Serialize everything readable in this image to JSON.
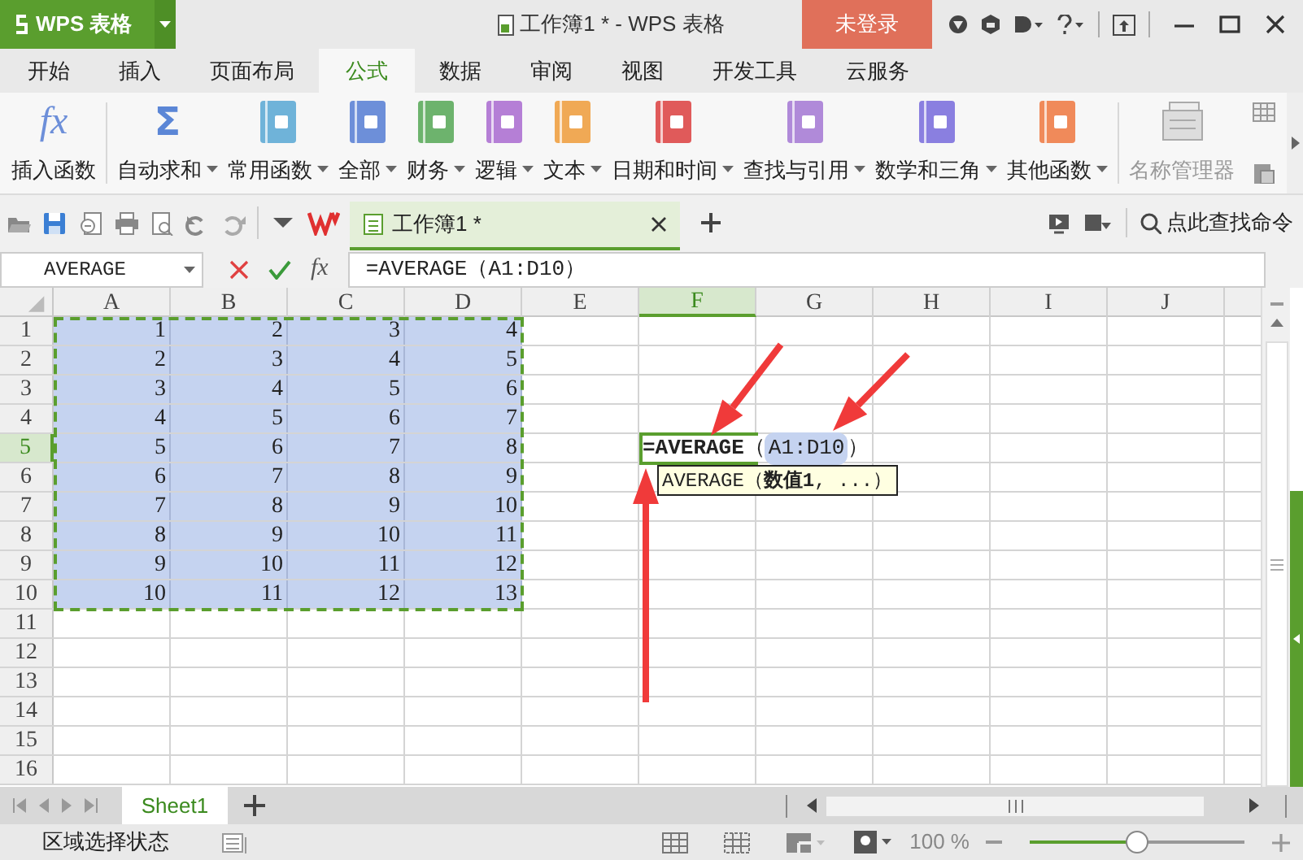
{
  "window": {
    "app_button": "WPS 表格",
    "title": "工作簿1 * - WPS 表格",
    "login_button": "未登录"
  },
  "menu_tabs": [
    {
      "label": "开始",
      "selected": false
    },
    {
      "label": "插入",
      "selected": false
    },
    {
      "label": "页面布局",
      "selected": false
    },
    {
      "label": "公式",
      "selected": true
    },
    {
      "label": "数据",
      "selected": false
    },
    {
      "label": "审阅",
      "selected": false
    },
    {
      "label": "视图",
      "selected": false
    },
    {
      "label": "开发工具",
      "selected": false
    },
    {
      "label": "云服务",
      "selected": false
    }
  ],
  "ribbon": [
    {
      "kind": "fx",
      "glyph": "fx",
      "label": "插入函数",
      "dropdown": false,
      "disabled": false
    },
    {
      "kind": "sigma",
      "glyph": "Σ",
      "label": "自动求和",
      "dropdown": true,
      "disabled": false
    },
    {
      "kind": "book",
      "label": "常用函数",
      "color": "#6fb3d9",
      "dropdown": true,
      "disabled": false
    },
    {
      "kind": "book",
      "label": "全部",
      "color": "#6d8fd9",
      "dropdown": true,
      "disabled": false
    },
    {
      "kind": "book",
      "label": "财务",
      "color": "#6db36d",
      "dropdown": true,
      "disabled": false
    },
    {
      "kind": "book",
      "label": "逻辑",
      "color": "#b57fd6",
      "dropdown": true,
      "disabled": false
    },
    {
      "kind": "book",
      "label": "文本",
      "color": "#f0a955",
      "dropdown": true,
      "disabled": false
    },
    {
      "kind": "book",
      "label": "日期和时间",
      "color": "#e05a5a",
      "dropdown": true,
      "disabled": false
    },
    {
      "kind": "book",
      "label": "查找与引用",
      "color": "#b08ad9",
      "dropdown": true,
      "disabled": false
    },
    {
      "kind": "book",
      "label": "数学和三角",
      "color": "#8a7fe0",
      "dropdown": true,
      "disabled": false
    },
    {
      "kind": "book",
      "label": "其他函数",
      "color": "#f08a5a",
      "dropdown": true,
      "disabled": false
    },
    {
      "kind": "manager",
      "label": "名称管理器",
      "dropdown": false,
      "disabled": true
    }
  ],
  "quick_access": {
    "doc_tab": "工作簿1 *",
    "search_command": "点此查找命令"
  },
  "formula_bar": {
    "name_box": "AVERAGE",
    "fx": "fx",
    "formula": "=AVERAGE（A1:D10）"
  },
  "sheet": {
    "columns": [
      {
        "label": "A",
        "active": false
      },
      {
        "label": "B",
        "active": false
      },
      {
        "label": "C",
        "active": false
      },
      {
        "label": "D",
        "active": false
      },
      {
        "label": "E",
        "active": false
      },
      {
        "label": "F",
        "active": true
      },
      {
        "label": "G",
        "active": false
      },
      {
        "label": "H",
        "active": false
      },
      {
        "label": "I",
        "active": false
      },
      {
        "label": "J",
        "active": false
      }
    ],
    "rows": [
      {
        "label": "1",
        "active": false,
        "cells": [
          {
            "value": "1",
            "in_range": true
          },
          {
            "value": "2",
            "in_range": true
          },
          {
            "value": "3",
            "in_range": true
          },
          {
            "value": "4",
            "in_range": true
          }
        ]
      },
      {
        "label": "2",
        "active": false,
        "cells": [
          {
            "value": "2",
            "in_range": true
          },
          {
            "value": "3",
            "in_range": true
          },
          {
            "value": "4",
            "in_range": true
          },
          {
            "value": "5",
            "in_range": true
          }
        ]
      },
      {
        "label": "3",
        "active": false,
        "cells": [
          {
            "value": "3",
            "in_range": true
          },
          {
            "value": "4",
            "in_range": true
          },
          {
            "value": "5",
            "in_range": true
          },
          {
            "value": "6",
            "in_range": true
          }
        ]
      },
      {
        "label": "4",
        "active": false,
        "cells": [
          {
            "value": "4",
            "in_range": true
          },
          {
            "value": "5",
            "in_range": true
          },
          {
            "value": "6",
            "in_range": true
          },
          {
            "value": "7",
            "in_range": true
          }
        ]
      },
      {
        "label": "5",
        "active": true,
        "cells": [
          {
            "value": "5",
            "in_range": true
          },
          {
            "value": "6",
            "in_range": true
          },
          {
            "value": "7",
            "in_range": true
          },
          {
            "value": "8",
            "in_range": true
          }
        ]
      },
      {
        "label": "6",
        "active": false,
        "cells": [
          {
            "value": "6",
            "in_range": true
          },
          {
            "value": "7",
            "in_range": true
          },
          {
            "value": "8",
            "in_range": true
          },
          {
            "value": "9",
            "in_range": true
          }
        ]
      },
      {
        "label": "7",
        "active": false,
        "cells": [
          {
            "value": "7",
            "in_range": true
          },
          {
            "value": "8",
            "in_range": true
          },
          {
            "value": "9",
            "in_range": true
          },
          {
            "value": "10",
            "in_range": true
          }
        ]
      },
      {
        "label": "8",
        "active": false,
        "cells": [
          {
            "value": "8",
            "in_range": true
          },
          {
            "value": "9",
            "in_range": true
          },
          {
            "value": "10",
            "in_range": true
          },
          {
            "value": "11",
            "in_range": true
          }
        ]
      },
      {
        "label": "9",
        "active": false,
        "cells": [
          {
            "value": "9",
            "in_range": true
          },
          {
            "value": "10",
            "in_range": true
          },
          {
            "value": "11",
            "in_range": true
          },
          {
            "value": "12",
            "in_range": true
          }
        ]
      },
      {
        "label": "10",
        "active": false,
        "cells": [
          {
            "value": "10",
            "in_range": true
          },
          {
            "value": "11",
            "in_range": true
          },
          {
            "value": "12",
            "in_range": true
          },
          {
            "value": "13",
            "in_range": true
          }
        ]
      },
      {
        "label": "11",
        "active": false
      },
      {
        "label": "12",
        "active": false
      },
      {
        "label": "13",
        "active": false
      },
      {
        "label": "14",
        "active": false
      },
      {
        "label": "15",
        "active": false
      },
      {
        "label": "16",
        "active": false
      }
    ],
    "editor": {
      "function": "=AVERAGE",
      "open_paren": "（",
      "range": "A1:D10",
      "close_paren": "）"
    },
    "tooltip": "AVERAGE（**数值1**, ...）"
  },
  "sheet_tabs": [
    {
      "label": "Sheet1",
      "selected": true
    }
  ],
  "status_bar": {
    "mode": "区域选择状态",
    "zoom": "100 %",
    "zoom_slider": {
      "level": 0.5
    }
  }
}
